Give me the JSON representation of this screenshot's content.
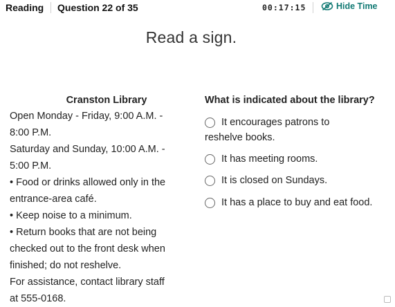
{
  "header": {
    "section": "Reading",
    "question_number": "Question 22 of 35",
    "timer": "00:17:15",
    "hide_time_label": "Hide Time"
  },
  "instruction": "Read a sign.",
  "passage": {
    "title": "Cranston Library",
    "lines": [
      "Open Monday - Friday, 9:00 A.M. -",
      "8:00 P.M.",
      "Saturday and Sunday, 10:00 A.M. -",
      "5:00 P.M.",
      "• Food or drinks allowed only in the",
      "entrance-area café.",
      "• Keep noise to a minimum.",
      "• Return books that are not being",
      "checked out to the front desk when",
      "finished; do not reshelve.",
      "For assistance, contact library staff",
      "at 555-0168."
    ]
  },
  "question": {
    "text": "What is indicated about the library?",
    "options": [
      {
        "line1": "It encourages patrons to",
        "line2": "reshelve books."
      },
      {
        "label": "It has meeting rooms."
      },
      {
        "label": "It is closed on Sundays."
      },
      {
        "label": "It has a place to buy and eat food."
      }
    ]
  },
  "icons": {
    "hide_time": "eye-slash-icon"
  },
  "colors": {
    "accent": "#127a74"
  }
}
